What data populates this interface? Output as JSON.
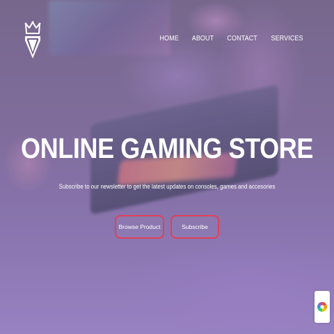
{
  "nav": {
    "items": [
      {
        "label": "HOME"
      },
      {
        "label": "ABOUT"
      },
      {
        "label": "CONTACT"
      },
      {
        "label": "SERVICES"
      }
    ]
  },
  "hero": {
    "title": "ONLINE GAMING STORE",
    "subtitle": "Subscribe to our newsletter to get the latest updates on consoles, games and accesories",
    "buttons": {
      "browse_label": "Browse Product",
      "subscribe_label": "Subscribe"
    }
  },
  "icons": {
    "logo": "crown-shield-logo",
    "badge": "color-wheel-icon"
  },
  "colors": {
    "accent": "#e0405a",
    "text": "#ffffff",
    "background": "#6d5a86"
  }
}
